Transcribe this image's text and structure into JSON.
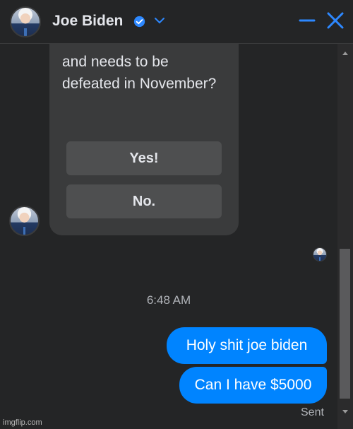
{
  "header": {
    "title": "Joe Biden",
    "verified_icon": "verified-badge-icon",
    "dropdown_icon": "chevron-down-icon",
    "minimize_icon": "minimize-icon",
    "close_icon": "close-icon"
  },
  "message_card": {
    "text": "and needs to be defeated in November?",
    "options": [
      "Yes!",
      "No."
    ]
  },
  "timestamp": "6:48 AM",
  "sent_messages": [
    "Holy shit joe biden",
    "Can I have $5000"
  ],
  "status": "Sent",
  "watermark": "imgflip.com",
  "colors": {
    "accent": "#0084ff",
    "background": "#242526",
    "card": "#3a3b3c",
    "button": "#4e4f50"
  }
}
